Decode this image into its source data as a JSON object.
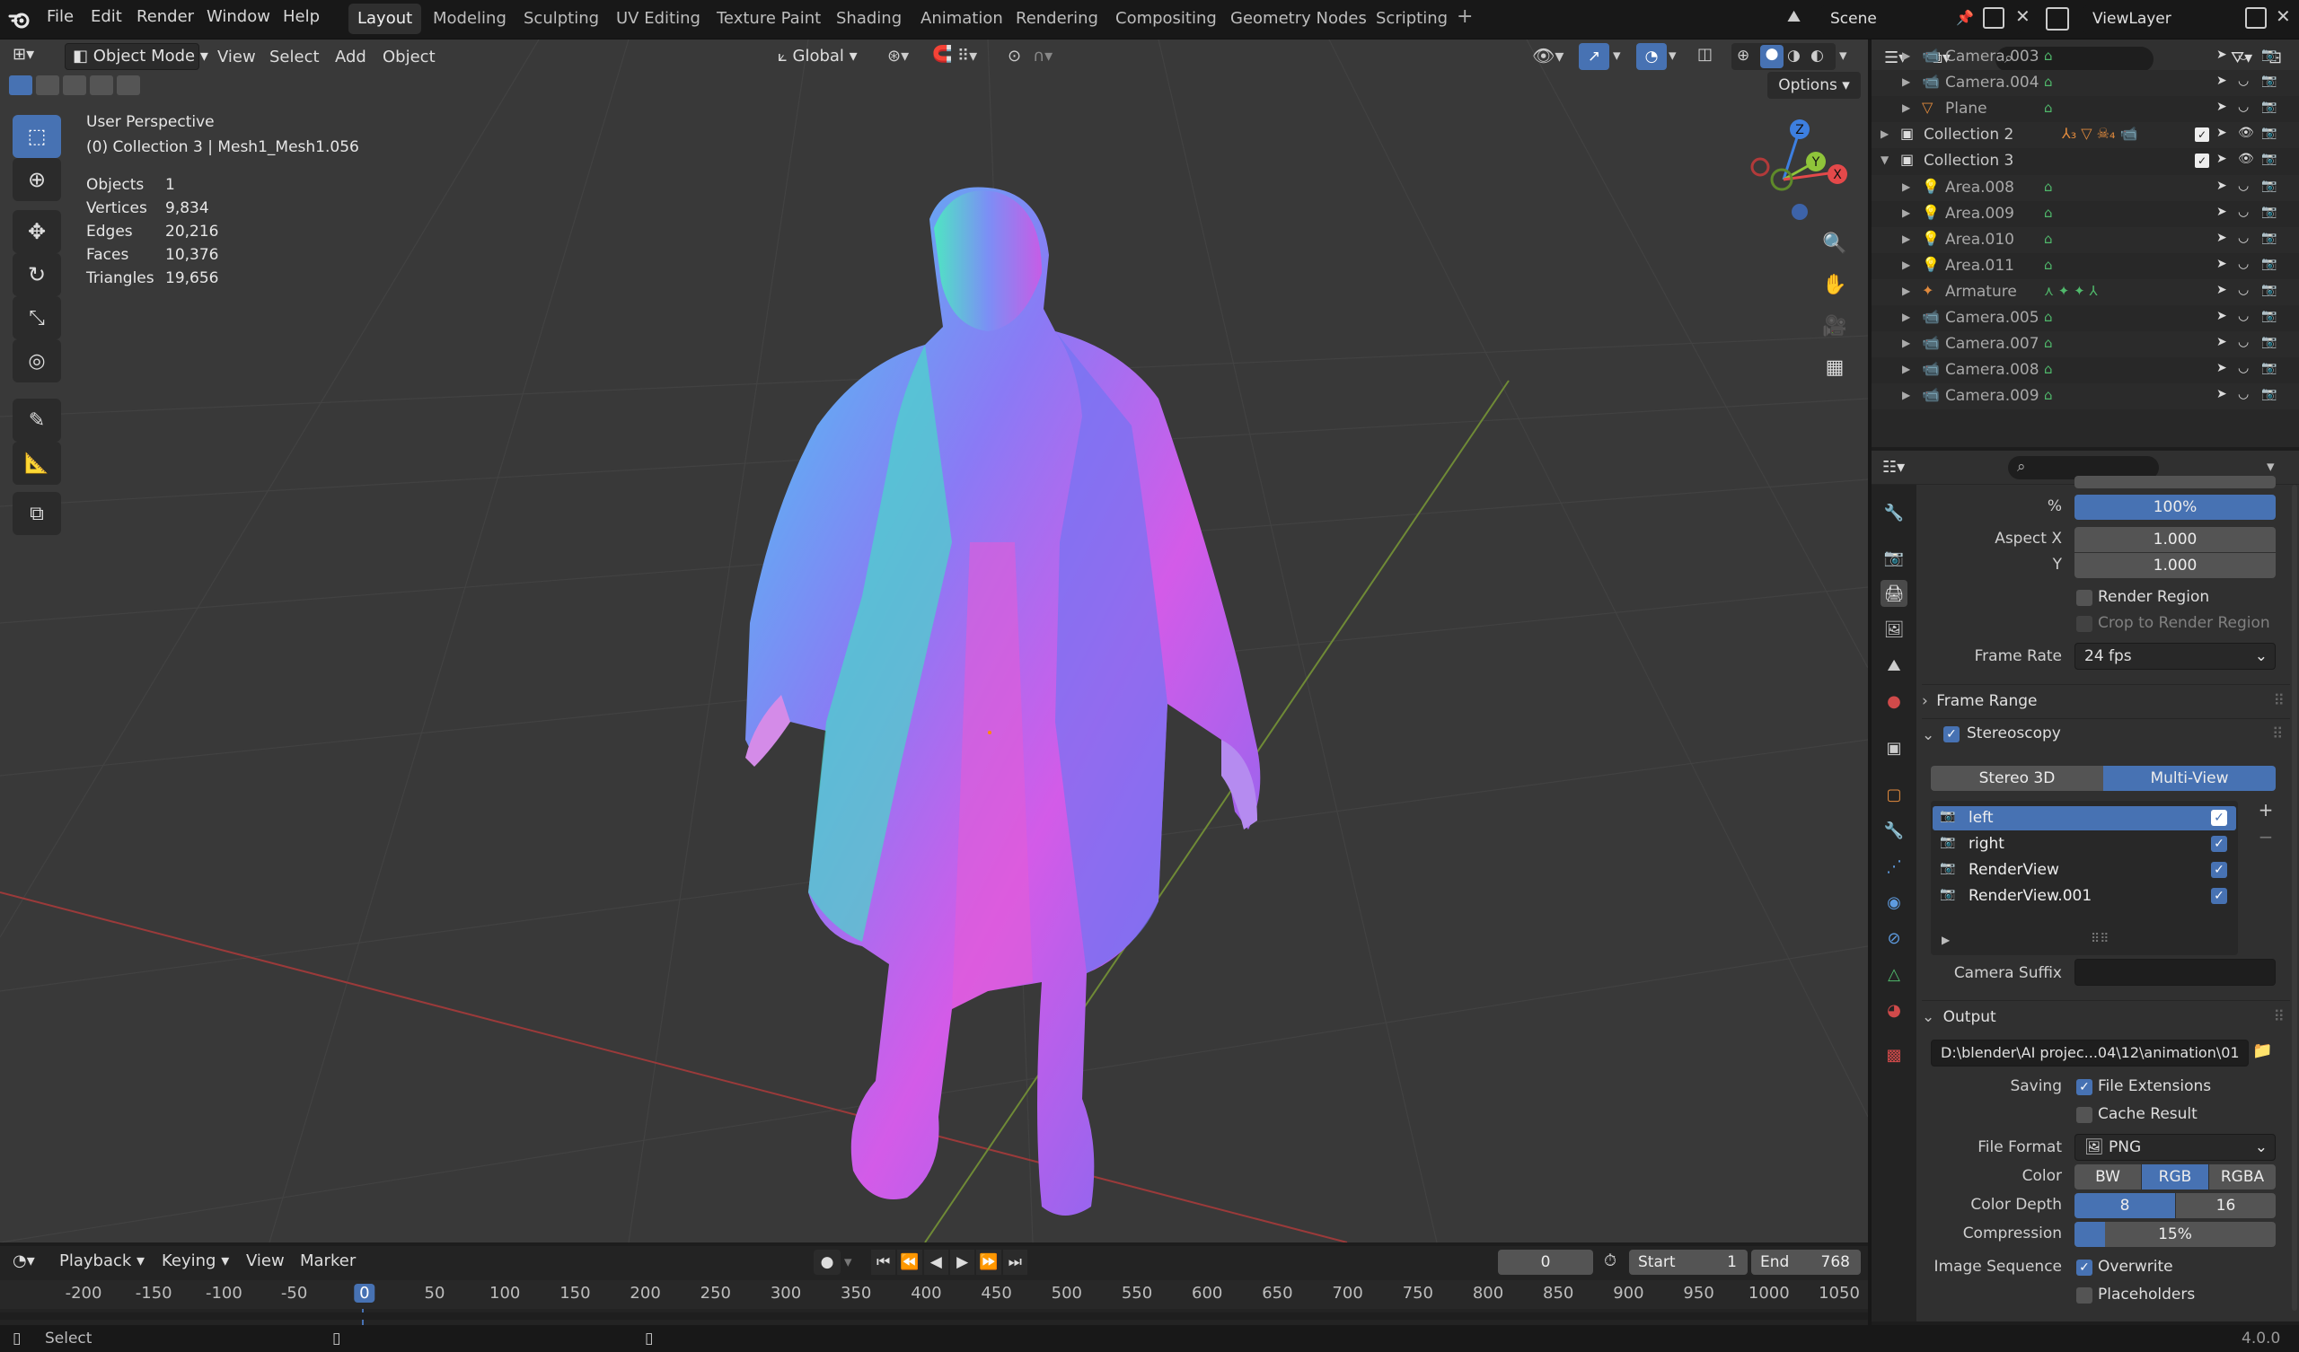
{
  "topbar": {
    "menus": [
      "File",
      "Edit",
      "Render",
      "Window",
      "Help"
    ],
    "workspaces": [
      "Layout",
      "Modeling",
      "Sculpting",
      "UV Editing",
      "Texture Paint",
      "Shading",
      "Animation",
      "Rendering",
      "Compositing",
      "Geometry Nodes",
      "Scripting"
    ],
    "active_workspace": "Layout",
    "scene": "Scene",
    "view_layer": "ViewLayer"
  },
  "viewport_header": {
    "mode": "Object Mode",
    "menus": [
      "View",
      "Select",
      "Add",
      "Object"
    ],
    "transform_orientation": "Global",
    "options_label": "Options"
  },
  "viewport_overlay": {
    "view_name": "User Perspective",
    "collection_info": "(0) Collection 3 | Mesh1_Mesh1.056",
    "stats": [
      {
        "label": "Objects",
        "value": "1"
      },
      {
        "label": "Vertices",
        "value": "9,834"
      },
      {
        "label": "Edges",
        "value": "20,216"
      },
      {
        "label": "Faces",
        "value": "10,376"
      },
      {
        "label": "Triangles",
        "value": "19,656"
      }
    ],
    "gizmo_axes": [
      "Z",
      "Y",
      "X"
    ]
  },
  "tools": [
    "select-box",
    "cursor",
    "move",
    "rotate",
    "scale",
    "transform",
    "annotate",
    "measure",
    "add-cube"
  ],
  "outliner": {
    "rows": [
      {
        "name": "Camera.003",
        "kind": "camera",
        "indent": 1
      },
      {
        "name": "Camera.004",
        "kind": "camera",
        "indent": 1
      },
      {
        "name": "Plane",
        "kind": "mesh",
        "indent": 1
      },
      {
        "name": "Collection 2",
        "kind": "collection",
        "indent": 0,
        "extra": "₃ ₄"
      },
      {
        "name": "Collection 3",
        "kind": "collection",
        "indent": 0,
        "expanded": true
      },
      {
        "name": "Area.008",
        "kind": "light",
        "indent": 1
      },
      {
        "name": "Area.009",
        "kind": "light",
        "indent": 1
      },
      {
        "name": "Area.010",
        "kind": "light",
        "indent": 1
      },
      {
        "name": "Area.011",
        "kind": "light",
        "indent": 1
      },
      {
        "name": "Armature",
        "kind": "armature",
        "indent": 1
      },
      {
        "name": "Camera.005",
        "kind": "camera",
        "indent": 1
      },
      {
        "name": "Camera.007",
        "kind": "camera",
        "indent": 1
      },
      {
        "name": "Camera.008",
        "kind": "camera",
        "indent": 1
      },
      {
        "name": "Camera.009",
        "kind": "camera",
        "indent": 1
      }
    ]
  },
  "properties": {
    "resolution_percent_label": "%",
    "resolution_percent": "100%",
    "aspect_x_label": "Aspect X",
    "aspect_x": "1.000",
    "aspect_y_label": "Y",
    "aspect_y": "1.000",
    "render_region": "Render Region",
    "crop_region": "Crop to Render Region",
    "frame_rate_label": "Frame Rate",
    "frame_rate": "24 fps",
    "frame_range_section": "Frame Range",
    "stereoscopy_section": "Stereoscopy",
    "stereo_modes": [
      "Stereo 3D",
      "Multi-View"
    ],
    "views": [
      "left",
      "right",
      "RenderView",
      "RenderView.001"
    ],
    "camera_suffix_label": "Camera Suffix",
    "camera_suffix": "",
    "output_section": "Output",
    "output_path": "D:\\blender\\AI projec...04\\12\\animation\\01",
    "saving_label": "Saving",
    "file_extensions": "File Extensions",
    "cache_result": "Cache Result",
    "file_format_label": "File Format",
    "file_format": "PNG",
    "color_label": "Color",
    "color_modes": [
      "BW",
      "RGB",
      "RGBA"
    ],
    "color_depth_label": "Color Depth",
    "color_depths": [
      "8",
      "16"
    ],
    "compression_label": "Compression",
    "compression": "15%",
    "compression_fraction": 0.15,
    "image_sequence_label": "Image Sequence",
    "overwrite": "Overwrite",
    "placeholders": "Placeholders"
  },
  "timeline": {
    "menus": [
      "Playback",
      "Keying",
      "View",
      "Marker"
    ],
    "current_frame": "0",
    "start_label": "Start",
    "start": "1",
    "end_label": "End",
    "end": "768",
    "ticks": [
      "-200",
      "-150",
      "-100",
      "-50",
      "0",
      "50",
      "100",
      "150",
      "200",
      "250",
      "300",
      "350",
      "400",
      "450",
      "500",
      "550",
      "600",
      "650",
      "700",
      "750",
      "800",
      "850",
      "900",
      "950",
      "1000",
      "1050"
    ]
  },
  "statusbar": {
    "left": "Select",
    "version": "4.0.0"
  },
  "colors": {
    "accent": "#4772b3",
    "x_axis": "#e4494a",
    "y_axis": "#8fc43a",
    "z_axis": "#3d7fe0",
    "orange_icon": "#e08a3d",
    "green_icon": "#50b86b"
  }
}
